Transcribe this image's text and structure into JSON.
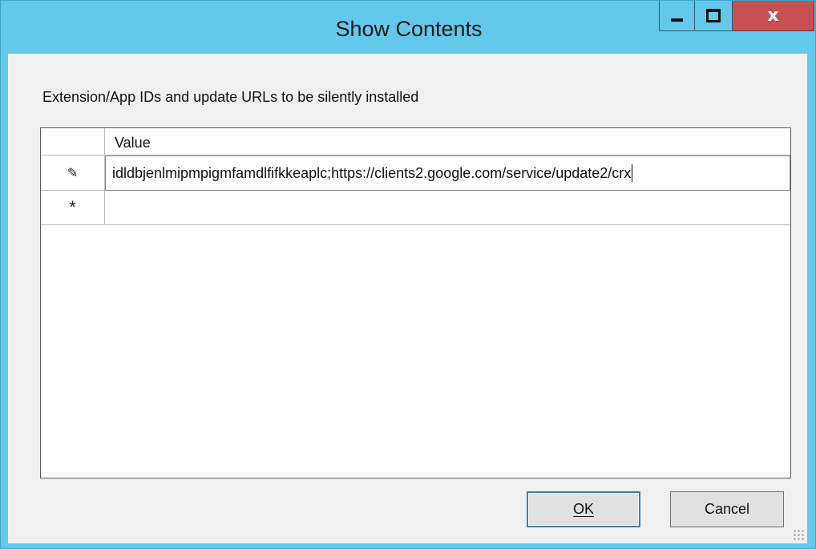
{
  "window": {
    "title": "Show Contents",
    "controls": {
      "minimize": "—",
      "maximize": "□",
      "close": "x"
    }
  },
  "caption": "Extension/App IDs and update URLs to be silently installed",
  "grid": {
    "column_header": "Value",
    "rows": [
      {
        "marker": "✎",
        "value": "idldbjenlmipmpigmfamdlfifkkeaplc;https://clients2.google.com/service/update2/crx"
      },
      {
        "marker": "*",
        "value": ""
      }
    ]
  },
  "buttons": {
    "ok": "OK",
    "cancel": "Cancel"
  },
  "colors": {
    "titlebar": "#64c8ea",
    "close": "#c75050",
    "client": "#f0f0f0"
  }
}
